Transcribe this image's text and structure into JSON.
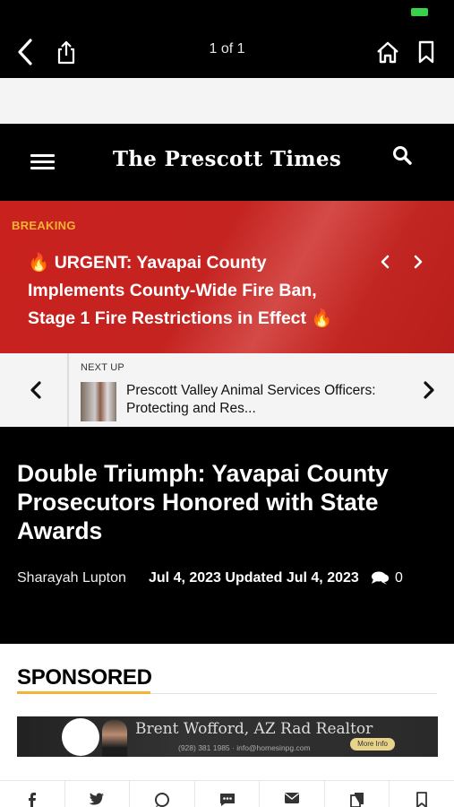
{
  "nav": {
    "page_count": "1 of 1",
    "icons": [
      "back-arrow-icon",
      "share-icon",
      "home-icon",
      "bookmark-icon"
    ]
  },
  "site": {
    "logo_text": "The Prescott Times",
    "icons": [
      "menu-icon",
      "search-icon"
    ]
  },
  "breaking": {
    "label": "BREAKING",
    "headline": "🔥 URGENT: Yavapai County Implements County-Wide Fire Ban, Stage 1 Fire Restrictions in Effect 🔥"
  },
  "next_up": {
    "label": "NEXT UP",
    "title": "Prescott Valley Animal Services Officers: Protecting and Res..."
  },
  "article": {
    "headline": "Double Triumph: Yavapai County Prosecutors Honored with State Awards",
    "author": "Sharayah Lupton",
    "date": "Jul 4, 2023 Updated Jul 4, 2023",
    "comment_count": "0"
  },
  "sponsored": {
    "heading": "SPONSORED",
    "ad": {
      "name": "Brent Wofford, AZ Rad Realtor",
      "contact": "(928) 381 1985 · info@homesinpg.com",
      "button": "More Info"
    }
  },
  "share_bar": [
    "facebook-icon",
    "twitter-icon",
    "whatsapp-icon",
    "sms-icon",
    "email-icon",
    "copy-icon",
    "bookmark-icon"
  ],
  "colors": {
    "breaking_red": "#c9211e",
    "accent_gold": "#f5b335",
    "battery_green": "#39d24a"
  }
}
